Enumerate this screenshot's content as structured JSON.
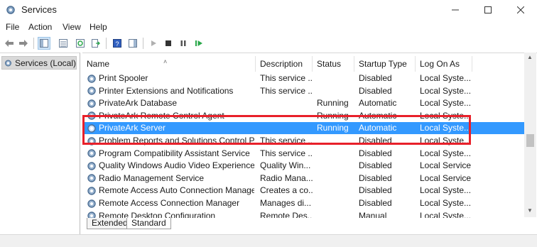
{
  "window": {
    "title": "Services"
  },
  "menu": {
    "items": [
      "File",
      "Action",
      "View",
      "Help"
    ]
  },
  "tree": {
    "root_label": "Services (Local)"
  },
  "columns": [
    "Name",
    "Description",
    "Status",
    "Startup Type",
    "Log On As"
  ],
  "rows": [
    {
      "name": "Print Spooler",
      "description": "This service ...",
      "status": "",
      "startup": "Disabled",
      "logon": "Local Syste..."
    },
    {
      "name": "Printer Extensions and Notifications",
      "description": "This service ...",
      "status": "",
      "startup": "Disabled",
      "logon": "Local Syste..."
    },
    {
      "name": "PrivateArk Database",
      "description": "",
      "status": "Running",
      "startup": "Automatic",
      "logon": "Local Syste..."
    },
    {
      "name": "PrivateArk Remote Control Agent",
      "description": "",
      "status": "Running",
      "startup": "Automatic",
      "logon": "Local Syste..."
    },
    {
      "name": "PrivateArk Server",
      "description": "",
      "status": "Running",
      "startup": "Automatic",
      "logon": "Local Syste..."
    },
    {
      "name": "Problem Reports and Solutions Control Pa...",
      "description": "This service ...",
      "status": "",
      "startup": "Disabled",
      "logon": "Local Syste..."
    },
    {
      "name": "Program Compatibility Assistant Service",
      "description": "This service ...",
      "status": "",
      "startup": "Disabled",
      "logon": "Local Syste..."
    },
    {
      "name": "Quality Windows Audio Video Experience",
      "description": "Quality Win...",
      "status": "",
      "startup": "Disabled",
      "logon": "Local Service"
    },
    {
      "name": "Radio Management Service",
      "description": "Radio Mana...",
      "status": "",
      "startup": "Disabled",
      "logon": "Local Service"
    },
    {
      "name": "Remote Access Auto Connection Manager",
      "description": "Creates a co...",
      "status": "",
      "startup": "Disabled",
      "logon": "Local Syste..."
    },
    {
      "name": "Remote Access Connection Manager",
      "description": "Manages di...",
      "status": "",
      "startup": "Disabled",
      "logon": "Local Syste..."
    },
    {
      "name": "Remote Desktop Configuration",
      "description": "Remote Des...",
      "status": "",
      "startup": "Manual",
      "logon": "Local Syste..."
    }
  ],
  "selected_row": "PrivateArk Server",
  "tabs": [
    "Extended",
    "Standard"
  ],
  "active_tab": "Standard",
  "colors": {
    "selection": "#3399ff",
    "highlight_border": "#e8202a",
    "toolbar_green": "#2aa84a"
  }
}
